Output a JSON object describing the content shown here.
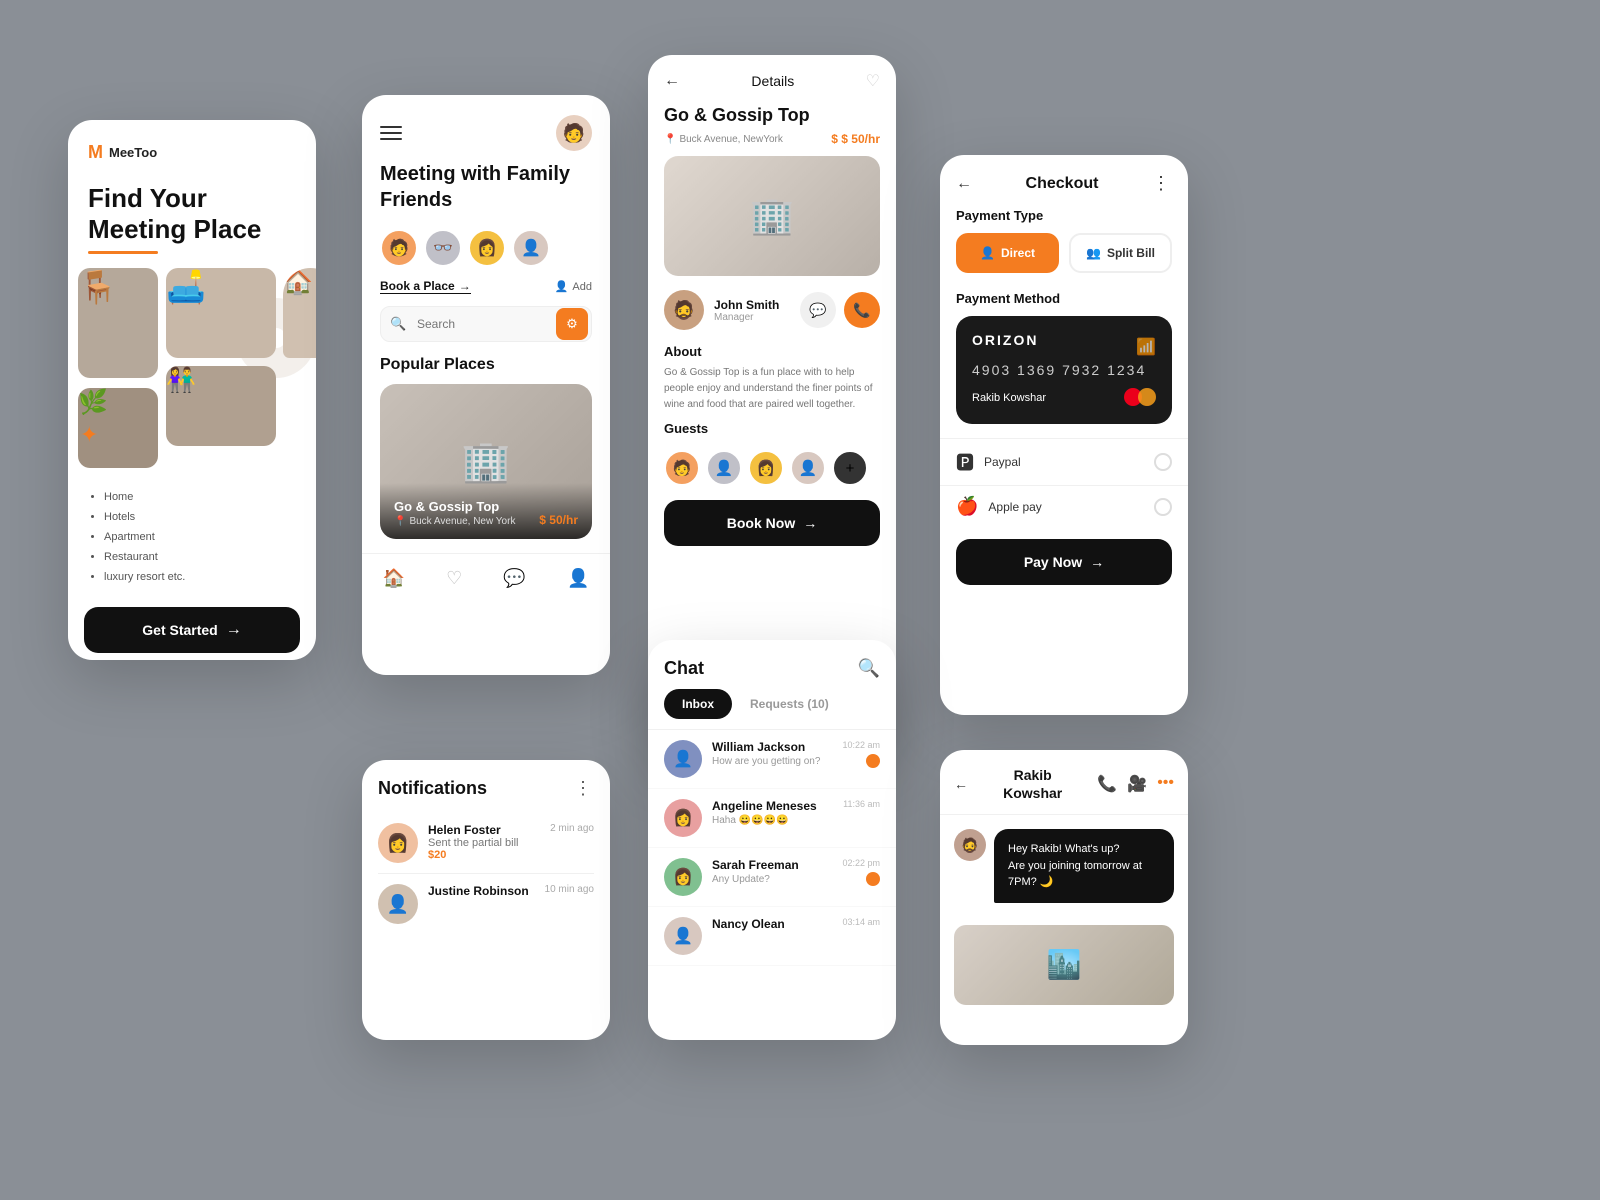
{
  "app": {
    "name": "MeeToo",
    "tagline": "Find Your Meeting Place"
  },
  "screen1": {
    "logo": "MeeToo",
    "headline_line1": "Find Your",
    "headline_line2": "Meeting Place",
    "menu_items": [
      "Home",
      "Hotels",
      "Apartment",
      "Restaurant",
      "luxury resort etc."
    ],
    "cta": "Get Started",
    "arrow": "→"
  },
  "screen2": {
    "meeting_title": "Meeting with Family Friends",
    "book_place": "Book a Place",
    "add_label": "Add",
    "search_placeholder": "Search",
    "popular_places": "Popular Places",
    "place_name": "Go & Gossip Top",
    "place_location": "Buck Avenue, New York",
    "place_price": "$ 50/hr"
  },
  "screen3": {
    "header_title": "Details",
    "place_name": "Go & Gossip Top",
    "location": "Buck Avenue, NewYork",
    "price": "$ 50/hr",
    "manager_name": "John Smith",
    "manager_role": "Manager",
    "about_title": "About",
    "about_text": "Go & Gossip Top is a fun place with to help people enjoy and understand the finer points of wine and food that are paired well together.",
    "guests_title": "Guests",
    "book_btn": "Book Now",
    "arrow": "→"
  },
  "screen4": {
    "header_title": "Checkout",
    "payment_type_label": "Payment Type",
    "direct_btn": "Direct",
    "split_bill_btn": "Split Bill",
    "payment_method_label": "Payment Method",
    "card_brand": "ORIZON",
    "card_number": "4903  1369  7932  1234",
    "card_holder": "Rakib Kowshar",
    "paypal_label": "Paypal",
    "apple_pay_label": "Apple pay",
    "pay_now_btn": "Pay Now",
    "arrow": "→"
  },
  "screen5": {
    "title": "Notifications",
    "notif1_name": "Helen Foster",
    "notif1_msg": "Sent the partial bill",
    "notif1_amount": "$20",
    "notif1_time": "2 min ago",
    "notif2_name": "Justine Robinson",
    "notif2_time": "10 min ago"
  },
  "screen6": {
    "title": "Chat",
    "tab_inbox": "Inbox",
    "tab_requests": "Requests (10)",
    "chat1_name": "William Jackson",
    "chat1_msg": "How are you getting on?",
    "chat1_time": "10:22 am",
    "chat2_name": "Angeline Meneses",
    "chat2_msg": "Haha 😀😀😀😀",
    "chat2_time": "11:36 am",
    "chat3_name": "Sarah Freeman",
    "chat3_msg": "Any Update?",
    "chat3_time": "02:22 pm",
    "chat4_name": "Nancy Olean",
    "chat4_time": "03:14 am"
  },
  "screen7": {
    "contact_name": "Rakib\nKowshar",
    "message": "Hey Rakib! What's up?\nAre you joining tomorrow at 7PM? 🌙"
  }
}
